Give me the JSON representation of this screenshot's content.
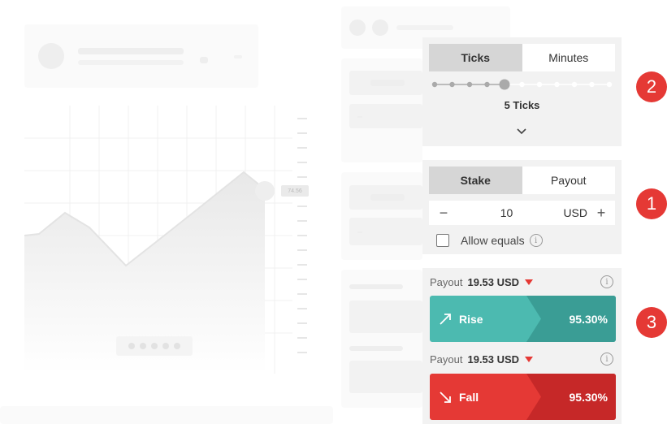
{
  "colors": {
    "rise": "#4cbab0",
    "rise_dark": "#3a9d95",
    "fall": "#e53935",
    "fall_dark": "#c62828",
    "badge": "#e53935"
  },
  "background": {
    "price_tag": "74.56"
  },
  "duration": {
    "tabs": [
      {
        "label": "Ticks",
        "active": true
      },
      {
        "label": "Minutes",
        "active": false
      }
    ],
    "slider_total": 11,
    "slider_selected": 5,
    "selected_label": "5 Ticks",
    "expand_icon": "chevron-down-icon"
  },
  "stake": {
    "tabs": [
      {
        "label": "Stake",
        "active": true
      },
      {
        "label": "Payout",
        "active": false
      }
    ],
    "minus": "−",
    "amount": "10",
    "currency": "USD",
    "plus": "+",
    "allow_equals_label": "Allow equals",
    "allow_equals_checked": false,
    "info": "i"
  },
  "purchase": {
    "payout_label": "Payout",
    "rise": {
      "payout": "19.53 USD",
      "label": "Rise",
      "percent": "95.30%"
    },
    "fall": {
      "payout": "19.53 USD",
      "label": "Fall",
      "percent": "95.30%"
    }
  },
  "badges": [
    {
      "number": "2"
    },
    {
      "number": "1"
    },
    {
      "number": "3"
    }
  ]
}
